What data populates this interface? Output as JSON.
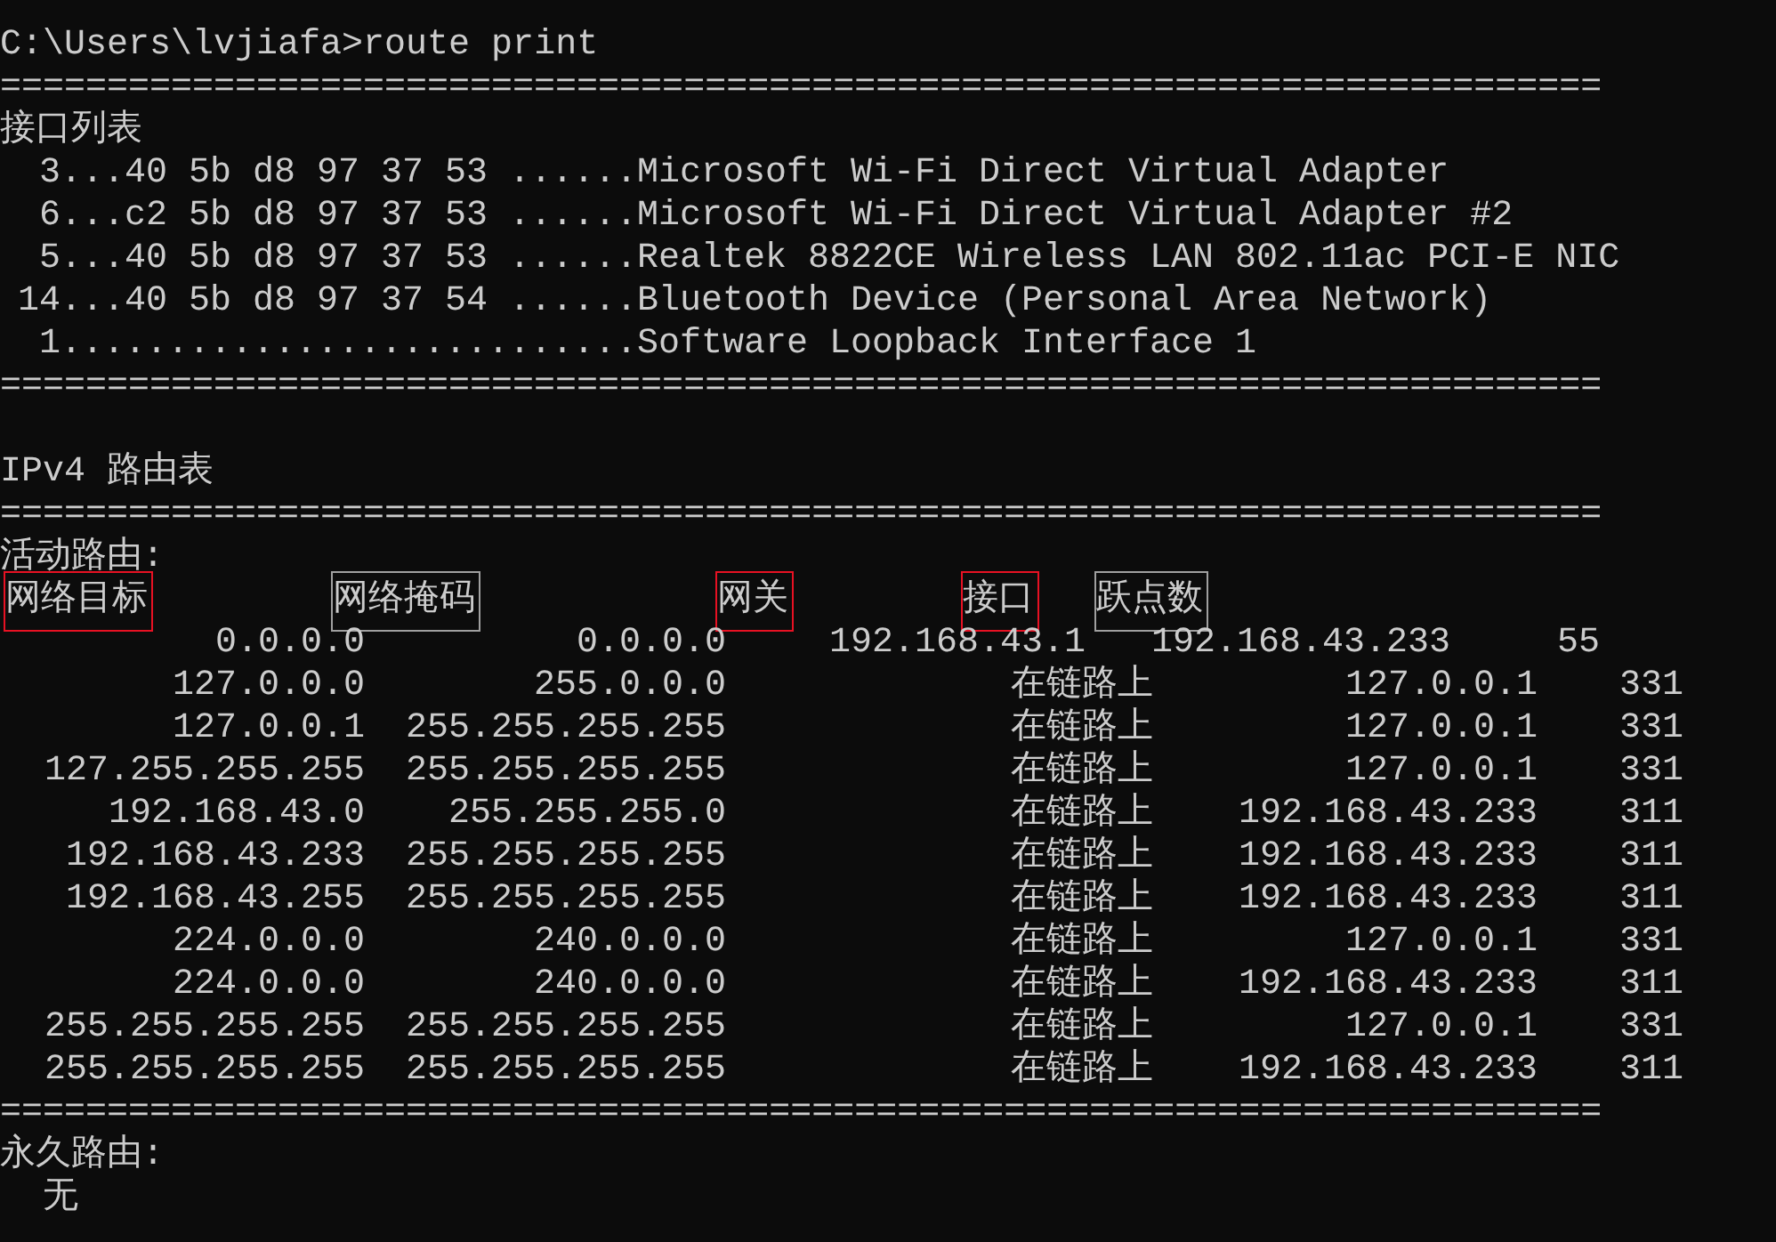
{
  "prompt": {
    "path": "C:\\Users\\lvjiafa>",
    "command": "route print"
  },
  "separator": "===========================================================================",
  "interface_list": {
    "title": "接口列表",
    "items": [
      {
        "prefix": "3...40 5b d8 97 37 53 ......",
        "name": "Microsoft Wi-Fi Direct Virtual Adapter"
      },
      {
        "prefix": "6...c2 5b d8 97 37 53 ......",
        "name": "Microsoft Wi-Fi Direct Virtual Adapter #2"
      },
      {
        "prefix": "5...40 5b d8 97 37 53 ......",
        "name": "Realtek 8822CE Wireless LAN 802.11ac PCI-E NIC"
      },
      {
        "prefix": "14...40 5b d8 97 37 54 ......",
        "name": "Bluetooth Device (Personal Area Network)"
      },
      {
        "prefix": "1...........................",
        "name": "Software Loopback Interface 1"
      }
    ]
  },
  "ipv4_table": {
    "title": "IPv4 路由表",
    "active_label": "活动路由:",
    "columns": [
      {
        "label": "网络目标",
        "color": "#e81123"
      },
      {
        "label": "网络掩码",
        "color": "#a0a0a0"
      },
      {
        "label": "网关",
        "color": "#e81123"
      },
      {
        "label": "接口",
        "color": "#e81123"
      },
      {
        "label": "跃点数",
        "color": "#a0a0a0"
      }
    ],
    "rows": [
      {
        "kind": "default",
        "cells": [
          "0.0.0.0",
          "0.0.0.0",
          "192.168.43.1",
          "192.168.43.233",
          "55"
        ]
      },
      {
        "kind": "onlink",
        "cells": [
          "127.0.0.0",
          "255.0.0.0",
          "在链路上",
          "127.0.0.1",
          "331"
        ]
      },
      {
        "kind": "onlink",
        "cells": [
          "127.0.0.1",
          "255.255.255.255",
          "在链路上",
          "127.0.0.1",
          "331"
        ]
      },
      {
        "kind": "onlink",
        "cells": [
          "127.255.255.255",
          "255.255.255.255",
          "在链路上",
          "127.0.0.1",
          "331"
        ]
      },
      {
        "kind": "onlink",
        "cells": [
          "192.168.43.0",
          "255.255.255.0",
          "在链路上",
          "192.168.43.233",
          "311"
        ]
      },
      {
        "kind": "onlink",
        "cells": [
          "192.168.43.233",
          "255.255.255.255",
          "在链路上",
          "192.168.43.233",
          "311"
        ]
      },
      {
        "kind": "onlink",
        "cells": [
          "192.168.43.255",
          "255.255.255.255",
          "在链路上",
          "192.168.43.233",
          "311"
        ]
      },
      {
        "kind": "onlink",
        "cells": [
          "224.0.0.0",
          "240.0.0.0",
          "在链路上",
          "127.0.0.1",
          "331"
        ]
      },
      {
        "kind": "onlink",
        "cells": [
          "224.0.0.0",
          "240.0.0.0",
          "在链路上",
          "192.168.43.233",
          "311"
        ]
      },
      {
        "kind": "onlink",
        "cells": [
          "255.255.255.255",
          "255.255.255.255",
          "在链路上",
          "127.0.0.1",
          "331"
        ]
      },
      {
        "kind": "onlink",
        "cells": [
          "255.255.255.255",
          "255.255.255.255",
          "在链路上",
          "192.168.43.233",
          "311"
        ]
      }
    ],
    "persistent_label": "永久路由:",
    "persistent_value": "无"
  }
}
